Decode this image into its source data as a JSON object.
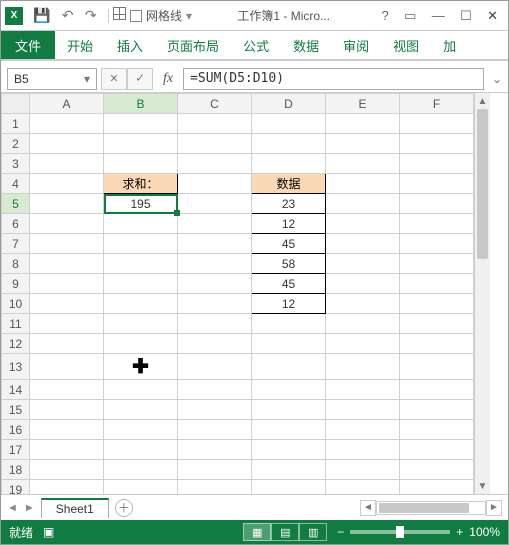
{
  "titlebar": {
    "app_label": "X",
    "gridlines_label": "网格线",
    "doc_title": "工作簿1 - Micro..."
  },
  "ribbon": {
    "file": "文件",
    "tabs": [
      "开始",
      "插入",
      "页面布局",
      "公式",
      "数据",
      "审阅",
      "视图",
      "加"
    ]
  },
  "formulabar": {
    "namebox": "B5",
    "cancel": "✕",
    "enter": "✓",
    "fx": "fx",
    "formula": "=SUM(D5:D10)"
  },
  "columns": [
    "A",
    "B",
    "C",
    "D",
    "E",
    "F"
  ],
  "rows_count": 20,
  "selection": {
    "col": "B",
    "row": 5
  },
  "cells": {
    "B4": {
      "value": "求和：",
      "style": "header-orange"
    },
    "B5": {
      "value": "195",
      "style": "boxed selected"
    },
    "D4": {
      "value": "数据",
      "style": "header-orange"
    },
    "D5": {
      "value": "23",
      "style": "boxed"
    },
    "D6": {
      "value": "12",
      "style": "boxed"
    },
    "D7": {
      "value": "45",
      "style": "boxed"
    },
    "D8": {
      "value": "58",
      "style": "boxed"
    },
    "D9": {
      "value": "45",
      "style": "boxed"
    },
    "D10": {
      "value": "12",
      "style": "boxed"
    }
  },
  "cursor_cell": "B13",
  "sheets": {
    "active": "Sheet1"
  },
  "statusbar": {
    "ready": "就绪",
    "rec": "",
    "zoom": "100%"
  }
}
